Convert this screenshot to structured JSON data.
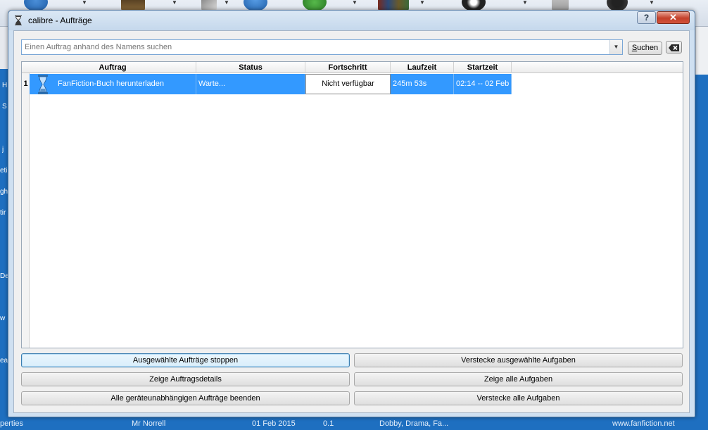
{
  "background": {
    "left_fragments": [
      "H",
      "S",
      "j",
      "eti",
      "gh",
      "tir",
      "De",
      "w",
      "ea"
    ],
    "status_bar": {
      "cells": [
        "perties",
        "Mr Norrell",
        "01 Feb 2015",
        "0.1",
        "Dobby, Drama, Fa...",
        "www.fanfiction.net"
      ]
    }
  },
  "dialog": {
    "title": "calibre - Aufträge",
    "help_label": "?",
    "close_label": "✕",
    "search": {
      "placeholder": "Einen Auftrag anhand des Namens suchen",
      "value": "",
      "button_underlined": "S",
      "button_rest": "uchen",
      "dropdown_glyph": "▼",
      "clear_glyph": "⌫"
    },
    "table": {
      "columns": [
        "Auftrag",
        "Status",
        "Fortschritt",
        "Laufzeit",
        "Startzeit"
      ],
      "rows": [
        {
          "index": "1",
          "job": "FanFiction-Buch herunterladen",
          "status": "Warte...",
          "progress": "Nicht verfügbar",
          "runtime": "245m 53s",
          "start": "02:14 -- 02 Feb"
        }
      ]
    },
    "buttons": {
      "stop_selected": "Ausgewählte Aufträge stoppen",
      "show_details": "Zeige Auftragsdetails",
      "kill_all": "Alle geräteunabhängigen Aufträge beenden",
      "hide_selected": "Verstecke ausgewählte Aufgaben",
      "show_all": "Zeige alle Aufgaben",
      "hide_all": "Verstecke alle Aufgaben"
    }
  },
  "colors": {
    "selection": "#3399ff",
    "desktop_blue": "#1e6fc0",
    "close_red": "#c4402b"
  }
}
